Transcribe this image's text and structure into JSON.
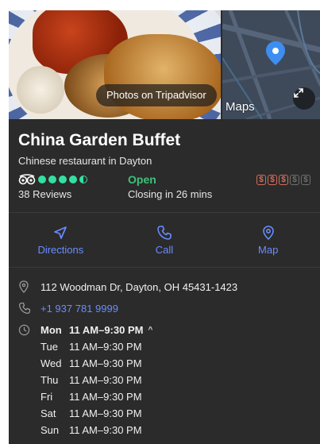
{
  "hero": {
    "photos_label": "Photos on Tripadvisor",
    "maps_label": "Maps"
  },
  "place": {
    "name": "China Garden Buffet",
    "category": "Chinese restaurant in Dayton",
    "rating": 4.5,
    "reviews": "38 Reviews",
    "status": "Open",
    "closing": "Closing in 26 mins",
    "price_level": 3,
    "price_max": 5
  },
  "actions": [
    {
      "label": "Directions",
      "icon": "directions-arrow-icon"
    },
    {
      "label": "Call",
      "icon": "phone-icon"
    },
    {
      "label": "Map",
      "icon": "map-pin-icon"
    }
  ],
  "details": {
    "address": "112 Woodman Dr, Dayton, OH 45431-1423",
    "phone": "+1 937 781 9999"
  },
  "hours": [
    {
      "day": "Mon",
      "time": "11 AM–9:30 PM"
    },
    {
      "day": "Tue",
      "time": "11 AM–9:30 PM"
    },
    {
      "day": "Wed",
      "time": "11 AM–9:30 PM"
    },
    {
      "day": "Thu",
      "time": "11 AM–9:30 PM"
    },
    {
      "day": "Fri",
      "time": "11 AM–9:30 PM"
    },
    {
      "day": "Sat",
      "time": "11 AM–9:30 PM"
    },
    {
      "day": "Sun",
      "time": "11 AM–9:30 PM"
    }
  ],
  "colors": {
    "card_bg": "#2b2b2b",
    "link_blue": "#6b8cff",
    "open_green": "#3ec27a",
    "rating_green": "#34e0a1",
    "price_red": "#d86b5b"
  }
}
